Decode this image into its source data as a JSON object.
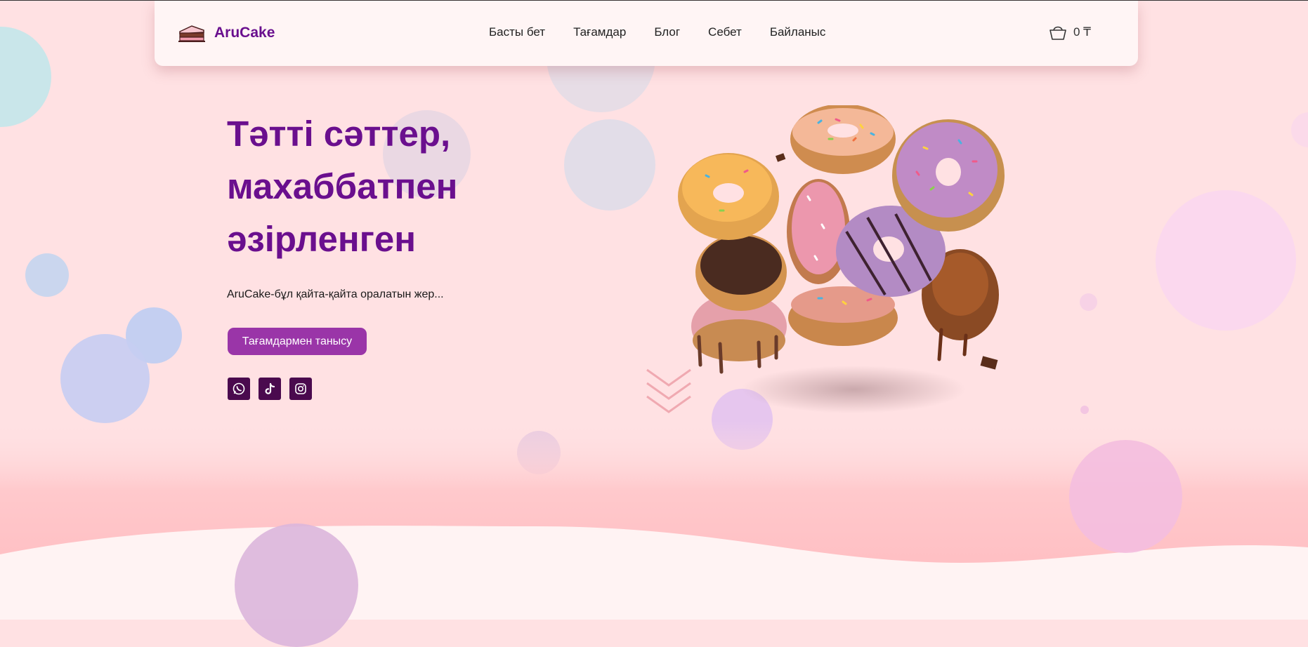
{
  "brand": {
    "name": "AruCake"
  },
  "nav": {
    "items": [
      {
        "label": "Басты бет"
      },
      {
        "label": "Тағамдар"
      },
      {
        "label": "Блог"
      },
      {
        "label": "Себет"
      },
      {
        "label": "Байланыс"
      }
    ]
  },
  "cart": {
    "amount": "0 ₸",
    "icon": "basket-icon"
  },
  "hero": {
    "title": "Тәтті сәттер, махаббатпен әзірленген",
    "subtitle": "AruCake-бұл қайта-қайта оралатын жер...",
    "cta_label": "Тағамдармен танысу"
  },
  "socials": [
    {
      "icon": "whatsapp-icon"
    },
    {
      "icon": "tiktok-icon"
    },
    {
      "icon": "instagram-icon"
    }
  ],
  "colors": {
    "brand": "#6a0f8e",
    "button": "#9a35a8",
    "social_bg": "#4a0a4e",
    "background": "#ffe1e3",
    "header_bg": "#fff5f5"
  }
}
